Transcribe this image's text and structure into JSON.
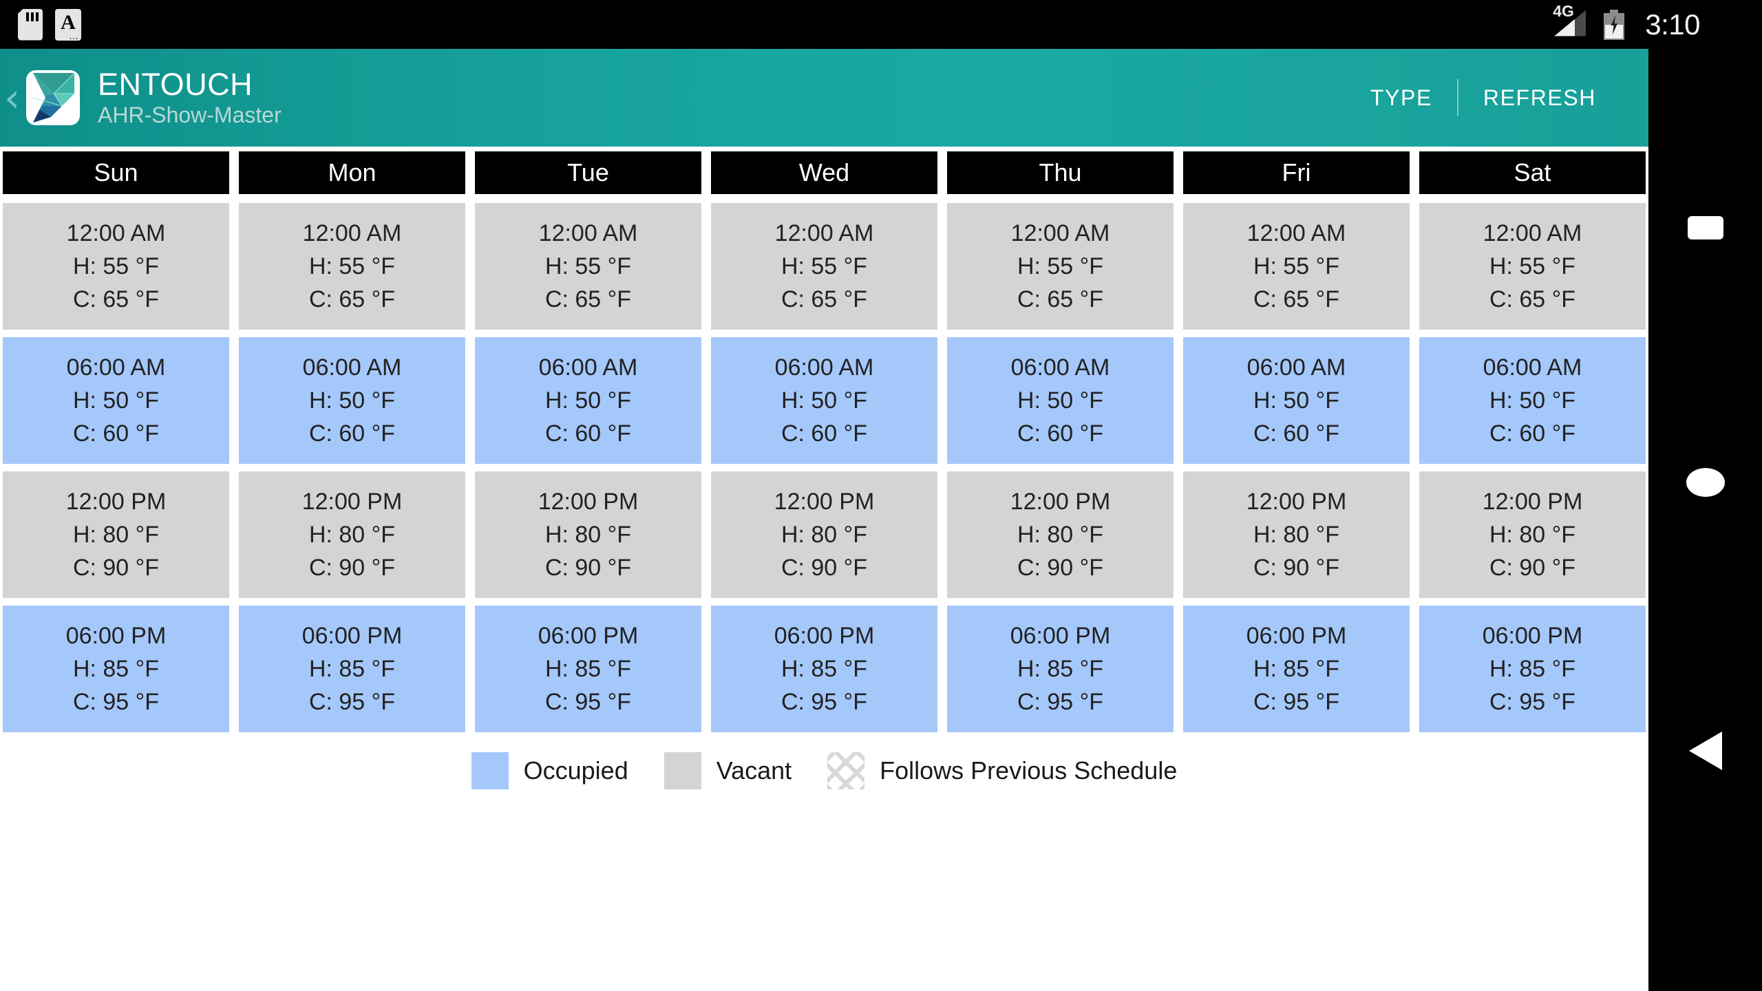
{
  "status_bar": {
    "icons": [
      "sd-card-icon",
      "font-size-icon"
    ],
    "network": "4G",
    "battery": "charging",
    "time": "3:10"
  },
  "app_bar": {
    "back_label": "‹",
    "logo": "entouch-logo",
    "title": "ENTOUCH",
    "subtitle": "AHR-Show-Master",
    "actions": [
      {
        "label": "TYPE",
        "name": "type-button"
      },
      {
        "label": "REFRESH",
        "name": "refresh-button"
      }
    ]
  },
  "schedule": {
    "days": [
      "Sun",
      "Mon",
      "Tue",
      "Wed",
      "Thu",
      "Fri",
      "Sat"
    ],
    "rows": [
      {
        "time": "12:00 AM",
        "heat": "H: 55 °F",
        "cool": "C: 65 °F",
        "state": "vacant"
      },
      {
        "time": "06:00 AM",
        "heat": "H: 50 °F",
        "cool": "C: 60 °F",
        "state": "occupied"
      },
      {
        "time": "12:00 PM",
        "heat": "H: 80 °F",
        "cool": "C: 90 °F",
        "state": "vacant"
      },
      {
        "time": "06:00 PM",
        "heat": "H: 85 °F",
        "cool": "C: 95 °F",
        "state": "occupied"
      }
    ]
  },
  "legend": [
    {
      "label": "Occupied",
      "swatch": "occupied",
      "color": "#a5c8fb"
    },
    {
      "label": "Vacant",
      "swatch": "vacant",
      "color": "#d4d4d4"
    },
    {
      "label": "Follows Previous Schedule",
      "swatch": "prev",
      "color": "#d8d8d8"
    }
  ],
  "nav_bar": {
    "overview": "overview-square-icon",
    "home": "home-circle-icon",
    "back": "back-triangle-icon"
  },
  "colors": {
    "accent_teal": "#18a099",
    "occupied_blue": "#a5c8fb",
    "vacant_gray": "#d4d4d4",
    "header_black": "#000000",
    "text_dark": "#222222"
  }
}
